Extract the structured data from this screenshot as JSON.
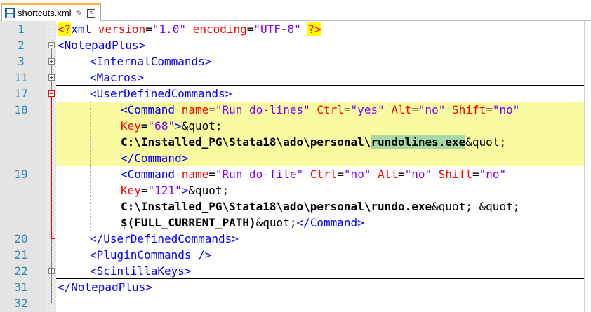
{
  "tab": {
    "filename": "shortcuts.xml",
    "pin_icon": "pin-icon",
    "close_icon": "close-icon",
    "file_icon": "floppy-disk-icon"
  },
  "colors": {
    "line_number": "#2b8ab8",
    "tag": "#0000ff",
    "attribute": "#ff0000",
    "attribute_value": "#8000ff",
    "current_line": "#fafaa0",
    "smart_highlight": "#a6d8a3",
    "active_tab_accent": "#f5b53f"
  },
  "line_numbers": [
    "1",
    "2",
    "3",
    "11",
    "17",
    "18",
    "19",
    "20",
    "21",
    "22",
    "31",
    "32"
  ],
  "code": {
    "l1": {
      "open": "<?",
      "xml": "xml",
      "a1": " version",
      "eq1": "=",
      "v1": "\"1.0\"",
      "a2": " encoding",
      "eq2": "=",
      "v2": "\"UTF-8\"",
      "sp": " ",
      "close": "?>"
    },
    "l2": {
      "tag": "<NotepadPlus>"
    },
    "l3": {
      "tag": "<InternalCommands>"
    },
    "l11": {
      "tag": "<Macros>"
    },
    "l17": {
      "tag": "<UserDefinedCommands>"
    },
    "l18": {
      "r1_tag": "<Command",
      "r1_a1": " name",
      "r1_e1": "=",
      "r1_v1": "\"Run do-lines\"",
      "r1_a2": " Ctrl",
      "r1_e2": "=",
      "r1_v2": "\"yes\"",
      "r1_a3": " Alt",
      "r1_e3": "=",
      "r1_v3": "\"no\"",
      "r1_a4": " Shift",
      "r1_e4": "=",
      "r1_v4": "\"no\"",
      "r2_a1": "Key",
      "r2_e1": "=",
      "r2_v1": "\"68\"",
      "r2_end": ">",
      "r2_ent": "&quot;",
      "r3_path_a": "C:\\Installed_PG\\Stata18\\ado\\personal\\",
      "r3_path_sel": "rundolines.exe",
      "r3_ent": "&quot;",
      "r4_tag": "</Command>"
    },
    "l19": {
      "r1_tag": "<Command",
      "r1_a1": " name",
      "r1_e1": "=",
      "r1_v1": "\"Run do-file\"",
      "r1_a2": " Ctrl",
      "r1_e2": "=",
      "r1_v2": "\"no\"",
      "r1_a3": " Alt",
      "r1_e3": "=",
      "r1_v3": "\"no\"",
      "r1_a4": " Shift",
      "r1_e4": "=",
      "r1_v4": "\"no\"",
      "r2_a1": "Key",
      "r2_e1": "=",
      "r2_v1": "\"121\"",
      "r2_end": ">",
      "r2_ent": "&quot;",
      "r3_path": "C:\\Installed_PG\\Stata18\\ado\\personal\\rundo.exe",
      "r3_ent": "&quot; &quot;",
      "r4_text": "$(FULL_CURRENT_PATH)",
      "r4_ent": "&quot;",
      "r4_tag": "</Command>"
    },
    "l20": {
      "tag": "</UserDefinedCommands>"
    },
    "l21": {
      "tag": "<PluginCommands />"
    },
    "l22": {
      "tag": "<ScintillaKeys>"
    },
    "l31": {
      "tag": "</NotepadPlus>"
    }
  }
}
